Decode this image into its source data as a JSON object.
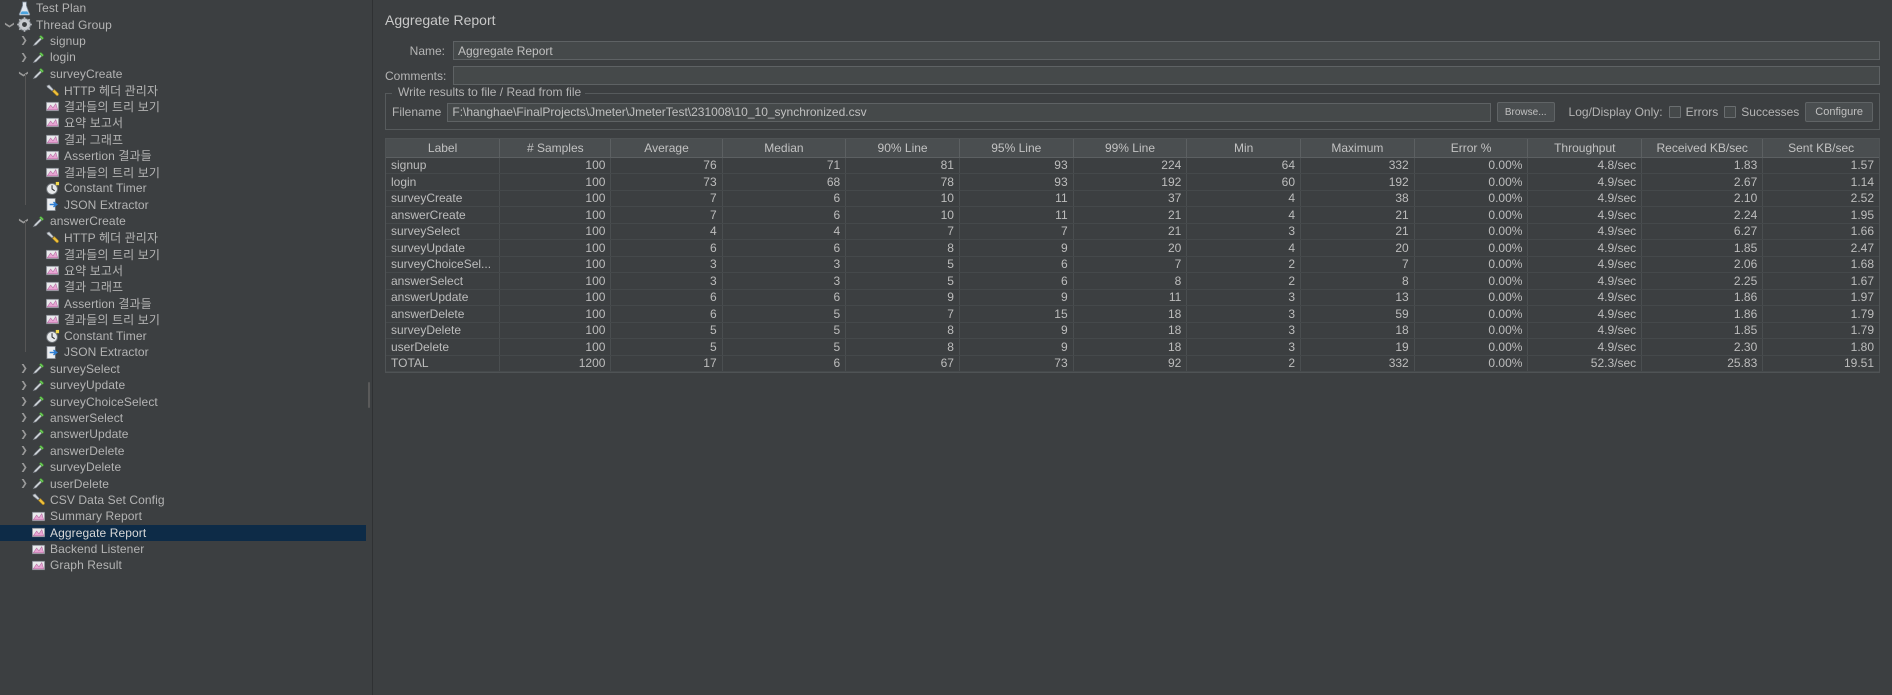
{
  "window": {
    "app": "Apache JMeter"
  },
  "tree": {
    "items": [
      {
        "label": "Test Plan",
        "depth": 0,
        "icon": "test-plan-icon",
        "twisty": "",
        "selected": false
      },
      {
        "label": "Thread Group",
        "depth": 0,
        "icon": "thread-group-icon",
        "twisty": "down",
        "selected": false
      },
      {
        "label": "signup",
        "depth": 1,
        "icon": "sampler-icon",
        "twisty": "right",
        "selected": false
      },
      {
        "label": "login",
        "depth": 1,
        "icon": "sampler-icon",
        "twisty": "right",
        "selected": false
      },
      {
        "label": "surveyCreate",
        "depth": 1,
        "icon": "sampler-icon",
        "twisty": "down",
        "selected": false
      },
      {
        "label": "HTTP 헤더 관리자",
        "depth": 2,
        "icon": "config-element-icon",
        "twisty": "",
        "selected": false
      },
      {
        "label": "결과들의 트리 보기",
        "depth": 2,
        "icon": "listener-icon",
        "twisty": "",
        "selected": false
      },
      {
        "label": "요약 보고서",
        "depth": 2,
        "icon": "listener-icon",
        "twisty": "",
        "selected": false
      },
      {
        "label": "결과 그래프",
        "depth": 2,
        "icon": "listener-icon",
        "twisty": "",
        "selected": false
      },
      {
        "label": "Assertion 결과들",
        "depth": 2,
        "icon": "listener-icon",
        "twisty": "",
        "selected": false
      },
      {
        "label": "결과들의 트리 보기",
        "depth": 2,
        "icon": "listener-icon",
        "twisty": "",
        "selected": false
      },
      {
        "label": "Constant Timer",
        "depth": 2,
        "icon": "timer-icon",
        "twisty": "",
        "selected": false
      },
      {
        "label": "JSON Extractor",
        "depth": 2,
        "icon": "post-processor-icon",
        "twisty": "",
        "selected": false
      },
      {
        "label": "answerCreate",
        "depth": 1,
        "icon": "sampler-icon",
        "twisty": "down",
        "selected": false
      },
      {
        "label": "HTTP 헤더 관리자",
        "depth": 2,
        "icon": "config-element-icon",
        "twisty": "",
        "selected": false
      },
      {
        "label": "결과들의 트리 보기",
        "depth": 2,
        "icon": "listener-icon",
        "twisty": "",
        "selected": false
      },
      {
        "label": "요약 보고서",
        "depth": 2,
        "icon": "listener-icon",
        "twisty": "",
        "selected": false
      },
      {
        "label": "결과 그래프",
        "depth": 2,
        "icon": "listener-icon",
        "twisty": "",
        "selected": false
      },
      {
        "label": "Assertion 결과들",
        "depth": 2,
        "icon": "listener-icon",
        "twisty": "",
        "selected": false
      },
      {
        "label": "결과들의 트리 보기",
        "depth": 2,
        "icon": "listener-icon",
        "twisty": "",
        "selected": false
      },
      {
        "label": "Constant Timer",
        "depth": 2,
        "icon": "timer-icon",
        "twisty": "",
        "selected": false
      },
      {
        "label": "JSON Extractor",
        "depth": 2,
        "icon": "post-processor-icon",
        "twisty": "",
        "selected": false
      },
      {
        "label": "surveySelect",
        "depth": 1,
        "icon": "sampler-icon",
        "twisty": "right",
        "selected": false
      },
      {
        "label": "surveyUpdate",
        "depth": 1,
        "icon": "sampler-icon",
        "twisty": "right",
        "selected": false
      },
      {
        "label": "surveyChoiceSelect",
        "depth": 1,
        "icon": "sampler-icon",
        "twisty": "right",
        "selected": false
      },
      {
        "label": "answerSelect",
        "depth": 1,
        "icon": "sampler-icon",
        "twisty": "right",
        "selected": false
      },
      {
        "label": "answerUpdate",
        "depth": 1,
        "icon": "sampler-icon",
        "twisty": "right",
        "selected": false
      },
      {
        "label": "answerDelete",
        "depth": 1,
        "icon": "sampler-icon",
        "twisty": "right",
        "selected": false
      },
      {
        "label": "surveyDelete",
        "depth": 1,
        "icon": "sampler-icon",
        "twisty": "right",
        "selected": false
      },
      {
        "label": "userDelete",
        "depth": 1,
        "icon": "sampler-icon",
        "twisty": "right",
        "selected": false
      },
      {
        "label": "CSV Data Set Config",
        "depth": 1,
        "icon": "config-element-icon",
        "twisty": "",
        "selected": false
      },
      {
        "label": "Summary Report",
        "depth": 1,
        "icon": "listener-icon",
        "twisty": "",
        "selected": false
      },
      {
        "label": "Aggregate Report",
        "depth": 1,
        "icon": "listener-icon",
        "twisty": "",
        "selected": true
      },
      {
        "label": "Backend Listener",
        "depth": 1,
        "icon": "listener-icon",
        "twisty": "",
        "selected": false
      },
      {
        "label": "Graph Result",
        "depth": 1,
        "icon": "listener-icon",
        "twisty": "",
        "selected": false
      }
    ]
  },
  "panel": {
    "title": "Aggregate Report",
    "name_label": "Name:",
    "name_value": "Aggregate Report",
    "comments_label": "Comments:",
    "comments_value": "",
    "comments_placeholder": "",
    "group_title": "Write results to file / Read from file",
    "filename_label": "Filename",
    "filename_value": "F:\\hanghae\\FinalProjects\\Jmeter\\JmeterTest\\231008\\10_10_synchronized.csv",
    "browse_label": "Browse...",
    "log_display_label": "Log/Display Only:",
    "errors_label": "Errors",
    "errors_checked": false,
    "successes_label": "Successes",
    "successes_checked": false,
    "configure_label": "Configure"
  },
  "chart_data": {
    "type": "table",
    "title": "Aggregate Report",
    "columns": [
      "Label",
      "# Samples",
      "Average",
      "Median",
      "90% Line",
      "95% Line",
      "99% Line",
      "Min",
      "Maximum",
      "Error %",
      "Throughput",
      "Received KB/sec",
      "Sent KB/sec"
    ],
    "rows": [
      [
        "signup",
        "100",
        "76",
        "71",
        "81",
        "93",
        "224",
        "64",
        "332",
        "0.00%",
        "4.8/sec",
        "1.83",
        "1.57"
      ],
      [
        "login",
        "100",
        "73",
        "68",
        "78",
        "93",
        "192",
        "60",
        "192",
        "0.00%",
        "4.9/sec",
        "2.67",
        "1.14"
      ],
      [
        "surveyCreate",
        "100",
        "7",
        "6",
        "10",
        "11",
        "37",
        "4",
        "38",
        "0.00%",
        "4.9/sec",
        "2.10",
        "2.52"
      ],
      [
        "answerCreate",
        "100",
        "7",
        "6",
        "10",
        "11",
        "21",
        "4",
        "21",
        "0.00%",
        "4.9/sec",
        "2.24",
        "1.95"
      ],
      [
        "surveySelect",
        "100",
        "4",
        "4",
        "7",
        "7",
        "21",
        "3",
        "21",
        "0.00%",
        "4.9/sec",
        "6.27",
        "1.66"
      ],
      [
        "surveyUpdate",
        "100",
        "6",
        "6",
        "8",
        "9",
        "20",
        "4",
        "20",
        "0.00%",
        "4.9/sec",
        "1.85",
        "2.47"
      ],
      [
        "surveyChoiceSel...",
        "100",
        "3",
        "3",
        "5",
        "6",
        "7",
        "2",
        "7",
        "0.00%",
        "4.9/sec",
        "2.06",
        "1.68"
      ],
      [
        "answerSelect",
        "100",
        "3",
        "3",
        "5",
        "6",
        "8",
        "2",
        "8",
        "0.00%",
        "4.9/sec",
        "2.25",
        "1.67"
      ],
      [
        "answerUpdate",
        "100",
        "6",
        "6",
        "9",
        "9",
        "11",
        "3",
        "13",
        "0.00%",
        "4.9/sec",
        "1.86",
        "1.97"
      ],
      [
        "answerDelete",
        "100",
        "6",
        "5",
        "7",
        "15",
        "18",
        "3",
        "59",
        "0.00%",
        "4.9/sec",
        "1.86",
        "1.79"
      ],
      [
        "surveyDelete",
        "100",
        "5",
        "5",
        "8",
        "9",
        "18",
        "3",
        "18",
        "0.00%",
        "4.9/sec",
        "1.85",
        "1.79"
      ],
      [
        "userDelete",
        "100",
        "5",
        "5",
        "8",
        "9",
        "18",
        "3",
        "19",
        "0.00%",
        "4.9/sec",
        "2.30",
        "1.80"
      ],
      [
        "TOTAL",
        "1200",
        "17",
        "6",
        "67",
        "73",
        "92",
        "2",
        "332",
        "0.00%",
        "52.3/sec",
        "25.83",
        "19.51"
      ]
    ]
  },
  "colors": {
    "background": "#3c3f41",
    "selection": "#0d2b47",
    "text": "#b4b4b4",
    "header": "#4a4e50",
    "border": "#5c6062"
  }
}
